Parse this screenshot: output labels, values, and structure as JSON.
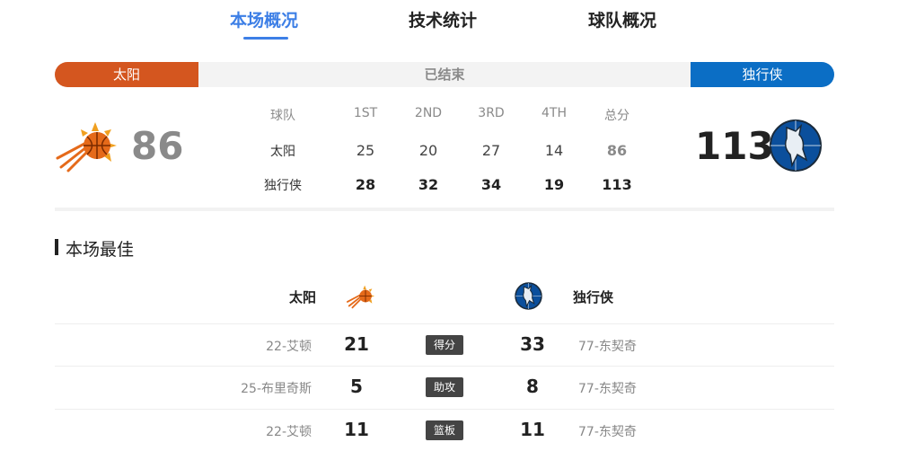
{
  "tabs": [
    {
      "label": "本场概况",
      "active": true
    },
    {
      "label": "技术统计",
      "active": false
    },
    {
      "label": "球队概况",
      "active": false
    }
  ],
  "status": {
    "home_team": "太阳",
    "away_team": "独行侠",
    "state": "已结束",
    "home_color": "#d4561f",
    "away_color": "#0b6ec5"
  },
  "scoreboard": {
    "home_score": "86",
    "away_score": "113",
    "home_logo": "suns-logo-icon",
    "away_logo": "mavericks-logo-icon",
    "headers": [
      "球队",
      "1ST",
      "2ND",
      "3RD",
      "4TH",
      "总分"
    ],
    "home_row": [
      "太阳",
      "25",
      "20",
      "27",
      "14",
      "86"
    ],
    "away_row": [
      "独行侠",
      "28",
      "32",
      "34",
      "19",
      "113"
    ]
  },
  "best": {
    "title": "本场最佳",
    "home_team": "太阳",
    "away_team": "独行侠",
    "rows": [
      {
        "home_player": "22-艾顿",
        "home_value": "21",
        "stat": "得分",
        "away_value": "33",
        "away_player": "77-东契奇"
      },
      {
        "home_player": "25-布里奇斯",
        "home_value": "5",
        "stat": "助攻",
        "away_value": "8",
        "away_player": "77-东契奇"
      },
      {
        "home_player": "22-艾顿",
        "home_value": "11",
        "stat": "篮板",
        "away_value": "11",
        "away_player": "77-东契奇"
      }
    ]
  }
}
